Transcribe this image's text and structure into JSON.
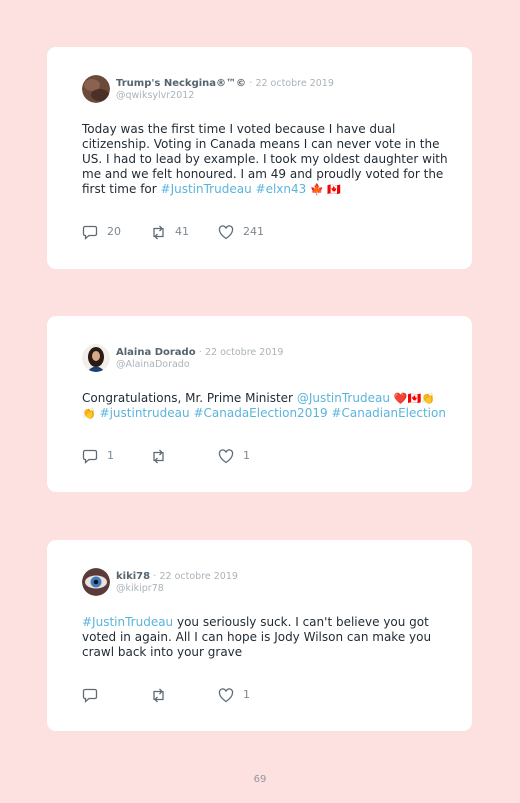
{
  "tweets": [
    {
      "name": "Trump's Neckgina®™©",
      "separator": "·",
      "date": "22 octobre 2019",
      "handle": "@qwiksylvr2012",
      "text_plain": "Today was the first time I voted because I have dual citizenship. Voting in Canada means I can never vote in the US. I had to lead by example. I took my oldest daughter with me and we felt honoured. I am 49 and proudly voted for the first time for ",
      "link1": "#JustinTrudeau",
      "link2": "#elxn43",
      "emoji": "🍁 🇨🇦",
      "replies": "20",
      "retweets": "41",
      "likes": "241"
    },
    {
      "name": "Alaina Dorado",
      "separator": "·",
      "date": "22 octobre 2019",
      "handle": "@AlainaDorado",
      "text_plain": "Congratulations, Mr. Prime Minister ",
      "mention": "@JustinTrudeau",
      "emoji1": "❤️🇨🇦👏",
      "emoji2": "👏",
      "link1": "#justintrudeau",
      "link2": "#CanadaElection2019",
      "link3": "#CanadianElection",
      "replies": "1",
      "likes": "1"
    },
    {
      "name": "kiki78",
      "separator": "·",
      "date": "22 octobre 2019",
      "handle": "@kikipr78",
      "link1": "#JustinTrudeau",
      "text_plain": " you seriously suck. I can't believe you got voted in again. All I can hope is Jody Wilson can make you crawl back into your grave",
      "likes": "1"
    }
  ],
  "page_number": "69",
  "colors": {
    "background": "#fde1e1",
    "card": "#ffffff",
    "link": "#5ab4dc",
    "muted": "#a9b3ba"
  },
  "icons": [
    "reply-icon",
    "retweet-icon",
    "heart-icon"
  ]
}
